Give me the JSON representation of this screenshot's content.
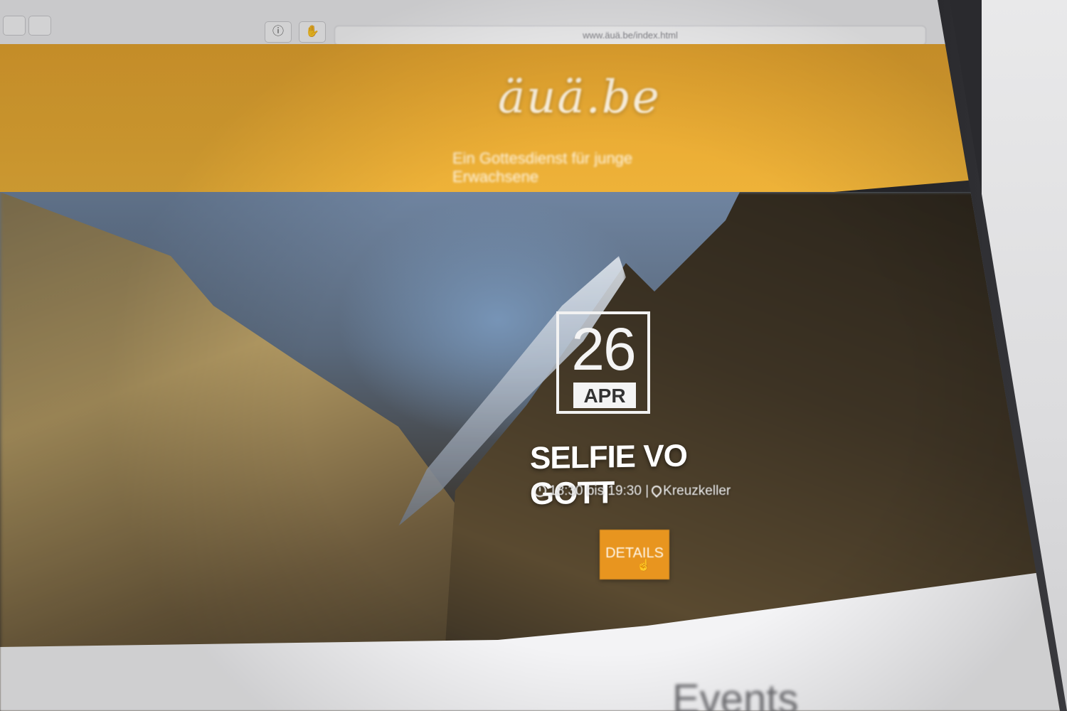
{
  "browser": {
    "url": "www.äuä.be/index.html",
    "ext_one_icon": "info-icon",
    "ext_two_icon": "shield-icon",
    "ext_one_glyph": "ⓘ",
    "ext_two_glyph": "✋"
  },
  "site": {
    "logo": "äuä.be",
    "tagline": "Ein Gottesdienst für junge Erwachsene",
    "brand_color": "#efb43a",
    "accent_color": "#e8951f"
  },
  "event": {
    "day": "26",
    "month": "APR",
    "title": "SELFIE VO GOTT",
    "time": "18:30 bis 19:30",
    "separator": "|",
    "location": "Kreuzkeller",
    "details_label": "DETAILS"
  },
  "sections": {
    "events_heading": "Events"
  }
}
